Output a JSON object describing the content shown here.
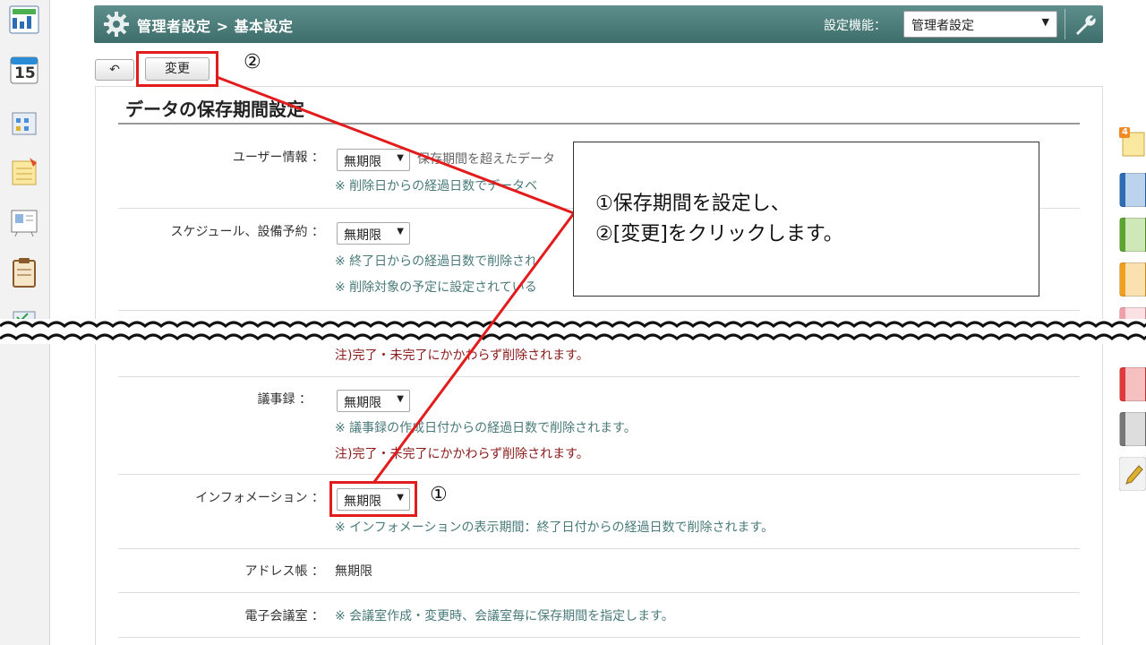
{
  "header": {
    "title": "管理者設定 > 基本設定",
    "function_label": "設定機能：",
    "function_select_value": "管理者設定"
  },
  "toolbar": {
    "change_label": "変更"
  },
  "section": {
    "title": "データの保存期間設定"
  },
  "rows": {
    "user": {
      "label": "ユーザー情報 ：",
      "value": "無期限",
      "note1": "保存期間を超えたデータ",
      "note2": "※ 削除日からの経過日数でデータベ"
    },
    "schedule": {
      "label": "スケジュール、設備予約 ：",
      "value": "無期限",
      "note1": "※ 終了日からの経過日数で削除され",
      "note2": "※ 削除対象の予定に設定されている"
    },
    "todo_warn": "注)完了・未完了にかかわらず削除されます。",
    "minutes": {
      "label": "議事録 ：",
      "value": "無期限",
      "note": "※ 議事録の作成日付からの経過日数で削除されます。",
      "warn": "注)完了・未完了にかかわらず削除されます。"
    },
    "information": {
      "label": "インフォメーション ：",
      "value": "無期限",
      "note": "※ インフォメーションの表示期間：終了日付からの経過日数で削除されます。"
    },
    "address": {
      "label": "アドレス帳 ：",
      "value": "無期限"
    },
    "meeting": {
      "label": "電子会議室 ：",
      "note": "※ 会議室作成・変更時、会議室毎に保存期間を指定します。"
    }
  },
  "annotations": {
    "marker1": "①",
    "marker2": "②",
    "callout_line1": "①保存期間を設定し、",
    "callout_line2": "②[変更]をクリックします。"
  },
  "rail": {
    "calendar_day": "15",
    "badge_count": "4"
  },
  "colors": {
    "header_top": "#5f8f8c",
    "header_bottom": "#3e6e6b",
    "highlight_red": "#e21c1c",
    "note_teal": "#4a7a7a",
    "warn_dark_red": "#8b1a1a"
  }
}
